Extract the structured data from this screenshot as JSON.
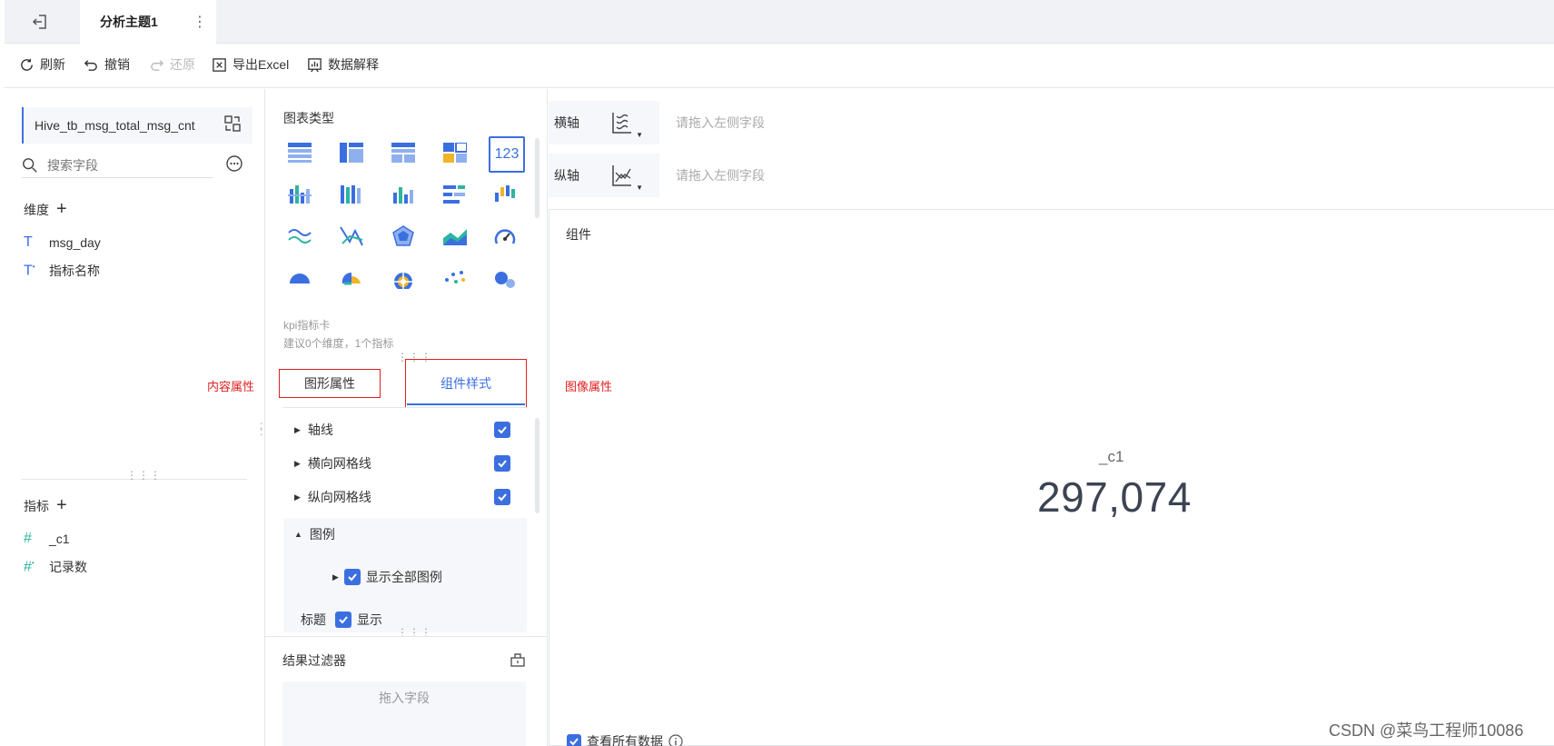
{
  "header": {
    "back_icon": "exit-icon",
    "tab_title": "分析主题1",
    "more_icon": "vertical-dots-icon"
  },
  "toolbar": {
    "refresh": "刷新",
    "undo": "撤销",
    "redo": "还原",
    "export": "导出Excel",
    "explain": "数据解释"
  },
  "left": {
    "dataset": "Hive_tb_msg_total_msg_cnt",
    "search_placeholder": "搜索字段",
    "dimensions_title": "维度",
    "dimensions": [
      "msg_day",
      "指标名称"
    ],
    "content_label": "内容属性",
    "metrics_title": "指标",
    "metrics": [
      "_c1",
      "记录数"
    ]
  },
  "middle": {
    "chart_types_title": "图表类型",
    "selected_chart": "123",
    "kpi_name": "kpi指标卡",
    "kpi_hint": "建议0个维度，1个指标",
    "tab_graph": "图形属性",
    "tab_style": "组件样式",
    "props": [
      "轴线",
      "横向网格线",
      "纵向网格线"
    ],
    "legend": "图例",
    "show_all_legend": "显示全部图例",
    "title_label": "标题",
    "title_show": "显示",
    "filter_title": "结果过滤器",
    "filter_drop": "拖入字段"
  },
  "right": {
    "x_axis": "横轴",
    "y_axis": "纵轴",
    "drop_hint": "请拖入左侧字段",
    "component_label": "组件",
    "image_label": "图像属性",
    "kpi_title": "_c1",
    "kpi_value": "297,074",
    "view_all": "查看所有数据"
  },
  "watermark": "CSDN @菜鸟工程师10086",
  "colors": {
    "accent": "#3b6fe0",
    "red": "#e02020",
    "teal": "#2cb5a0"
  }
}
